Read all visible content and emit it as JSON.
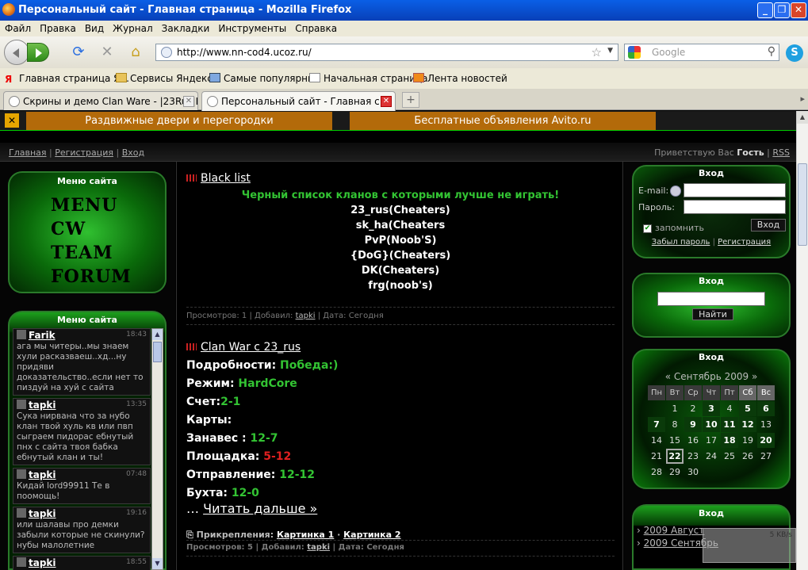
{
  "window": {
    "title": "Персональный сайт - Главная страница - Mozilla Firefox"
  },
  "menubar": [
    "Файл",
    "Правка",
    "Вид",
    "Журнал",
    "Закладки",
    "Инструменты",
    "Справка"
  ],
  "nav": {
    "url": "http://www.nn-cod4.ucoz.ru/",
    "search_placeholder": "Google"
  },
  "bookmarks": [
    {
      "label": "Главная страница Я...",
      "icon": "yandex-icon"
    },
    {
      "label": "Сервисы Яндекса",
      "icon": "folder-icon"
    },
    {
      "label": "Самые популярные",
      "icon": "popular-icon"
    },
    {
      "label": "Начальная страница",
      "icon": "page-icon"
    },
    {
      "label": "Лента новостей",
      "icon": "rss-icon"
    }
  ],
  "tabs": [
    {
      "label": "Скрины и демо Clan Ware - |23Rus|K..."
    },
    {
      "label": "Персональный сайт - Главная с..."
    }
  ],
  "ads": [
    "Раздвижные двери и перегородки",
    "Бесплатные объявления Avito.ru"
  ],
  "topnav": {
    "links": [
      "Главная",
      "Регистрация",
      "Вход"
    ],
    "greeting": "Приветствую Вас",
    "user": "Гость",
    "rss": "RSS"
  },
  "left": {
    "menu_title": "Меню сайта",
    "menu_items": [
      "MENU",
      "CW",
      "TEAM",
      "FORUM"
    ],
    "chat_title": "Меню сайта",
    "chat": [
      {
        "name": "Farik",
        "time": "18:43",
        "text": "ага мы читеры..мы знаем хули расказваеш..хд...ну придяви доказательство..если нет то пиздуй на хуй с сайта"
      },
      {
        "name": "tapki",
        "time": "13:35",
        "text": "Сука нирвана что за нубо клан твой хуль кв или пвп сыграем пидорас ебнутый пнх с сайта твоя бабка ебнутый клан и ты!"
      },
      {
        "name": "tapki",
        "time": "07:48",
        "text": "Кидай lord99911 Те в поомощь!"
      },
      {
        "name": "tapki",
        "time": "19:16",
        "text": "или шалавы про демки забыли которые не скинули?нубы малолетние"
      },
      {
        "name": "tapki",
        "time": "18:55",
        "text": ""
      }
    ]
  },
  "posts": {
    "p1": {
      "title": "Black list",
      "subtitle": "Черный список кланов с которыми лучше не играть!",
      "lines": [
        "23_rus(Cheaters)",
        "sk_ha(Cheaters",
        "PvP(Noob'S)",
        "{DoG}(Cheaters)",
        "DK(Cheaters)",
        "frg(noob's)"
      ],
      "views_label": "Просмотров:",
      "views": "1",
      "added_label": "Добавил:",
      "author": "tapki",
      "date_label": "Дата:",
      "date": "Сегодня"
    },
    "p2": {
      "title": "Clan War с 23_rus",
      "details_label": "Подробности:",
      "details": "Победа:)",
      "mode_label": "Режим:",
      "mode": "HardCore",
      "score_label": "Счет:",
      "score": "2-1",
      "maps_label": "Карты:",
      "m1_label": "Занавес :",
      "m1": "12-7",
      "m2_label": "Площадка:",
      "m2": "5-12",
      "m3_label": "Отправление:",
      "m3": "12-12",
      "m4_label": "Бухта:",
      "m4": "12-0",
      "more": "Читать дальше »",
      "attach_label": "Прикрепления:",
      "attach1": "Картинка 1",
      "attach2": "Картинка 2",
      "views_label": "Просмотров:",
      "views": "5",
      "added_label": "Добавил:",
      "author": "tapki",
      "date_label": "Дата:",
      "date": "Сегодня"
    }
  },
  "login": {
    "title": "Вход",
    "email_label": "E-mail:",
    "pass_label": "Пароль:",
    "remember": "запомнить",
    "submit": "Вход",
    "forgot": "Забыл пароль",
    "register": "Регистрация"
  },
  "search": {
    "title": "Вход",
    "button": "Найти"
  },
  "calendar": {
    "title": "Вход",
    "month": "Сентябрь 2009",
    "days": [
      "Пн",
      "Вт",
      "Ср",
      "Чт",
      "Пт",
      "Сб",
      "Вс"
    ],
    "weeks": [
      [
        "",
        "1",
        "2",
        "3",
        "4",
        "5",
        "6"
      ],
      [
        "7",
        "8",
        "9",
        "10",
        "11",
        "12",
        "13"
      ],
      [
        "14",
        "15",
        "16",
        "17",
        "18",
        "19",
        "20"
      ],
      [
        "21",
        "22",
        "23",
        "24",
        "25",
        "26",
        "27"
      ],
      [
        "28",
        "29",
        "30",
        "",
        "",
        "",
        ""
      ]
    ],
    "bold_days": [
      "3",
      "5",
      "6",
      "7",
      "9",
      "10",
      "11",
      "12",
      "18",
      "20"
    ],
    "today": "22"
  },
  "archive": {
    "title": "Вход",
    "items": [
      "2009 Август",
      "2009 Сентябрь"
    ]
  },
  "download": {
    "speed": "5 KB/s"
  }
}
